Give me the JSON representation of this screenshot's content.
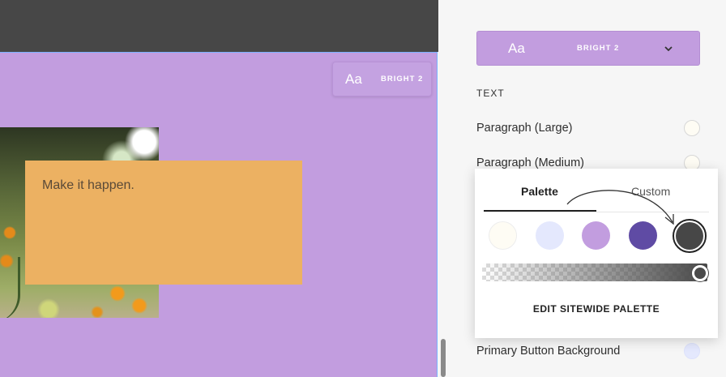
{
  "canvas": {
    "block_theme": {
      "aa": "Aa",
      "name": "BRIGHT 2"
    },
    "text_block": {
      "text": "Make it happen."
    },
    "colors": {
      "topbar": "#474747",
      "section": "#c29ddf",
      "card": "#ecb162"
    }
  },
  "panel": {
    "theme_select": {
      "aa": "Aa",
      "name": "BRIGHT 2",
      "icon": "chevron-down-icon"
    },
    "text_heading": "TEXT",
    "rows": [
      {
        "label": "Paragraph (Large)",
        "swatch": "#fefcf4"
      },
      {
        "label": "Paragraph (Medium)",
        "swatch": "#fefcf4"
      },
      {
        "label": "Primary Button Background",
        "swatch": "#e4e8fd"
      }
    ]
  },
  "popover": {
    "tabs": [
      {
        "label": "Palette",
        "active": true
      },
      {
        "label": "Custom",
        "active": false
      }
    ],
    "swatches": [
      "#fefcf4",
      "#e4e8fd",
      "#c29ddf",
      "#5f4ba4",
      "#474747"
    ],
    "selected_swatch": "#474747",
    "opacity_percent": 100,
    "edit_link": "EDIT SITEWIDE PALETTE"
  }
}
